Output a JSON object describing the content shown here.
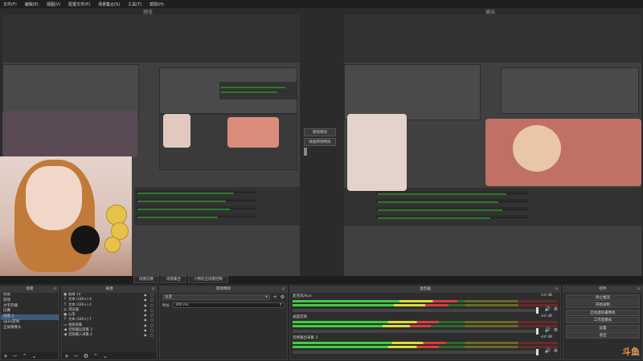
{
  "menubar": {
    "items": [
      "文件(F)",
      "编辑(E)",
      "视图(V)",
      "配置文件(P)",
      "场景集合(S)",
      "工具(T)",
      "帮助(H)"
    ]
  },
  "panes": {
    "preview_label": "预览",
    "program_label": "输出"
  },
  "transition_panel": {
    "transition_button": "转场特效",
    "quick_transition": "快速转场特效",
    "plus": "+"
  },
  "tabs": [
    "场景切换",
    "场景集合",
    "小熊的全场景控制"
  ],
  "docks": {
    "scenes": {
      "title": "场景",
      "items": [
        "场景",
        "游戏",
        "文字开播",
        "比赛",
        "场景 2",
        "apex游戏",
        "全屏摄像头"
      ],
      "selected_index": 4
    },
    "sources": {
      "title": "来源",
      "items": [
        {
          "icon": "image-icon",
          "glyph": "▣",
          "name": "图像 10"
        },
        {
          "icon": "text-icon",
          "glyph": "T",
          "name": "文本 (GDI+) 4"
        },
        {
          "icon": "text-icon",
          "glyph": "T",
          "name": "文本 (GDI+) 4"
        },
        {
          "icon": "browser-icon",
          "glyph": "◎",
          "name": "浏览器"
        },
        {
          "icon": "image-icon",
          "glyph": "▣",
          "name": "心形"
        },
        {
          "icon": "text-icon",
          "glyph": "T",
          "name": "文本 (GDI+) 7"
        },
        {
          "icon": "camera-icon",
          "glyph": "▭",
          "name": "视频采集"
        },
        {
          "icon": "speaker-icon",
          "glyph": "◀",
          "name": "音频输出采集 3"
        },
        {
          "icon": "mic-icon",
          "glyph": "◀",
          "name": "音频输入采集 2"
        }
      ]
    },
    "transitions": {
      "title": "转场特效",
      "mode": "淡变",
      "duration_label": "时长",
      "duration_value": "300 ms"
    },
    "mixer": {
      "title": "混音器",
      "tracks": [
        {
          "name": "麦克风/Aux",
          "db": "-inf dB",
          "level": 0.62
        },
        {
          "name": "桌面音频",
          "db": "-inf dB",
          "level": 0.55
        },
        {
          "name": "音频输出采集 3",
          "db": "-inf dB",
          "level": 0.58
        }
      ]
    },
    "controls": {
      "title": "控件",
      "buttons": [
        "停止推流",
        "开始录制",
        "启动虚拟摄像机",
        "工作室模式",
        "设置",
        "退出"
      ]
    }
  },
  "watermark": "斗鱼",
  "colors": {
    "background": "#2b2b2b",
    "panel": "#2d2d2d",
    "selection": "#3c5b7a",
    "meter_green": "#3fcf3f",
    "meter_yellow": "#dcdc3c",
    "meter_red": "#dc3c3c",
    "watermark": "#f0a050"
  }
}
